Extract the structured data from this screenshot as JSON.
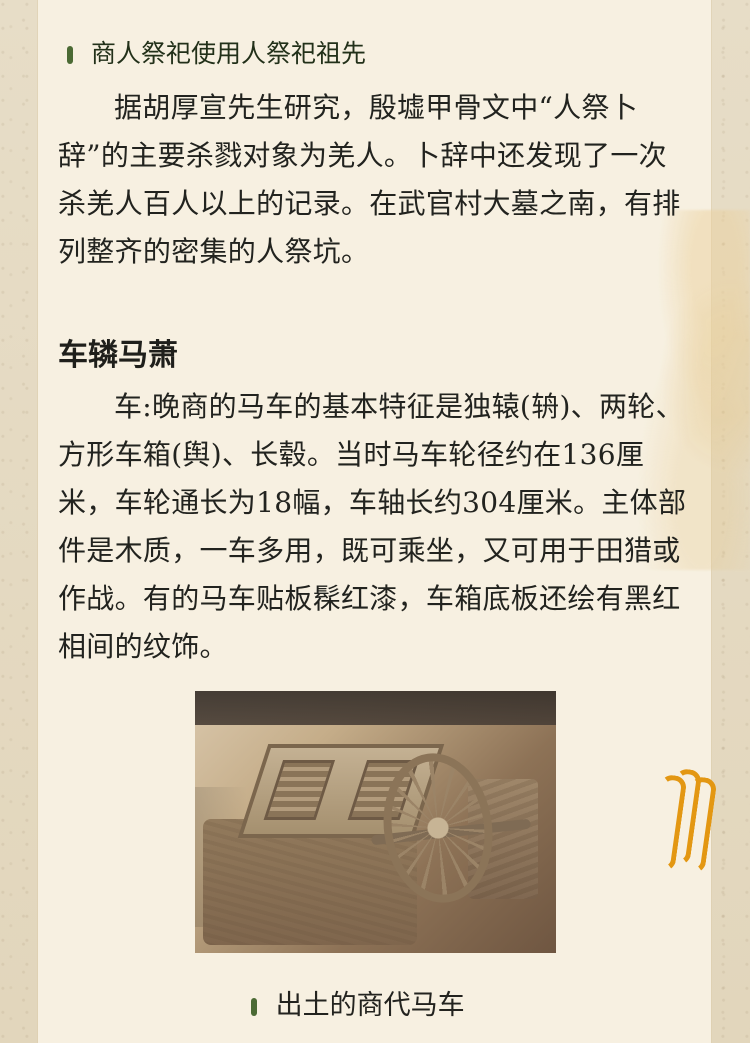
{
  "sections": {
    "subheading": "商人祭祀使用人祭祀祖先",
    "paragraph_1": "据胡厚宣先生研究，殷墟甲骨文中“人祭卜辞”的主要杀戮对象为羌人。卜辞中还发现了一次杀羌人百人以上的记录。在武官村大墓之南，有排列整齐的密集的人祭坑。",
    "heading": "车辚马萧",
    "paragraph_2": "车:晚商的马车的基本特征是独辕(辀)、两轮、方形车箱(舆)、长毂。当时马车轮径约在136厘米，车轮通长为18幅，车轴长约304厘米。主体部件是木质，一车多用，既可乘坐，又可用于田猎或作战。有的马车贴板髹红漆，车箱底板还绘有黑红相间的纹饰。"
  },
  "image": {
    "caption": "出土的商代马车"
  },
  "icons": {
    "marker": "green-marker-icon",
    "ornament": "orange-wave-ornament-icon"
  },
  "colors": {
    "paper": "#f7f0e1",
    "background": "#e6dcc4",
    "accent_green": "#4b6a34",
    "accent_orange": "#e39712",
    "text_dark": "#22231f"
  }
}
